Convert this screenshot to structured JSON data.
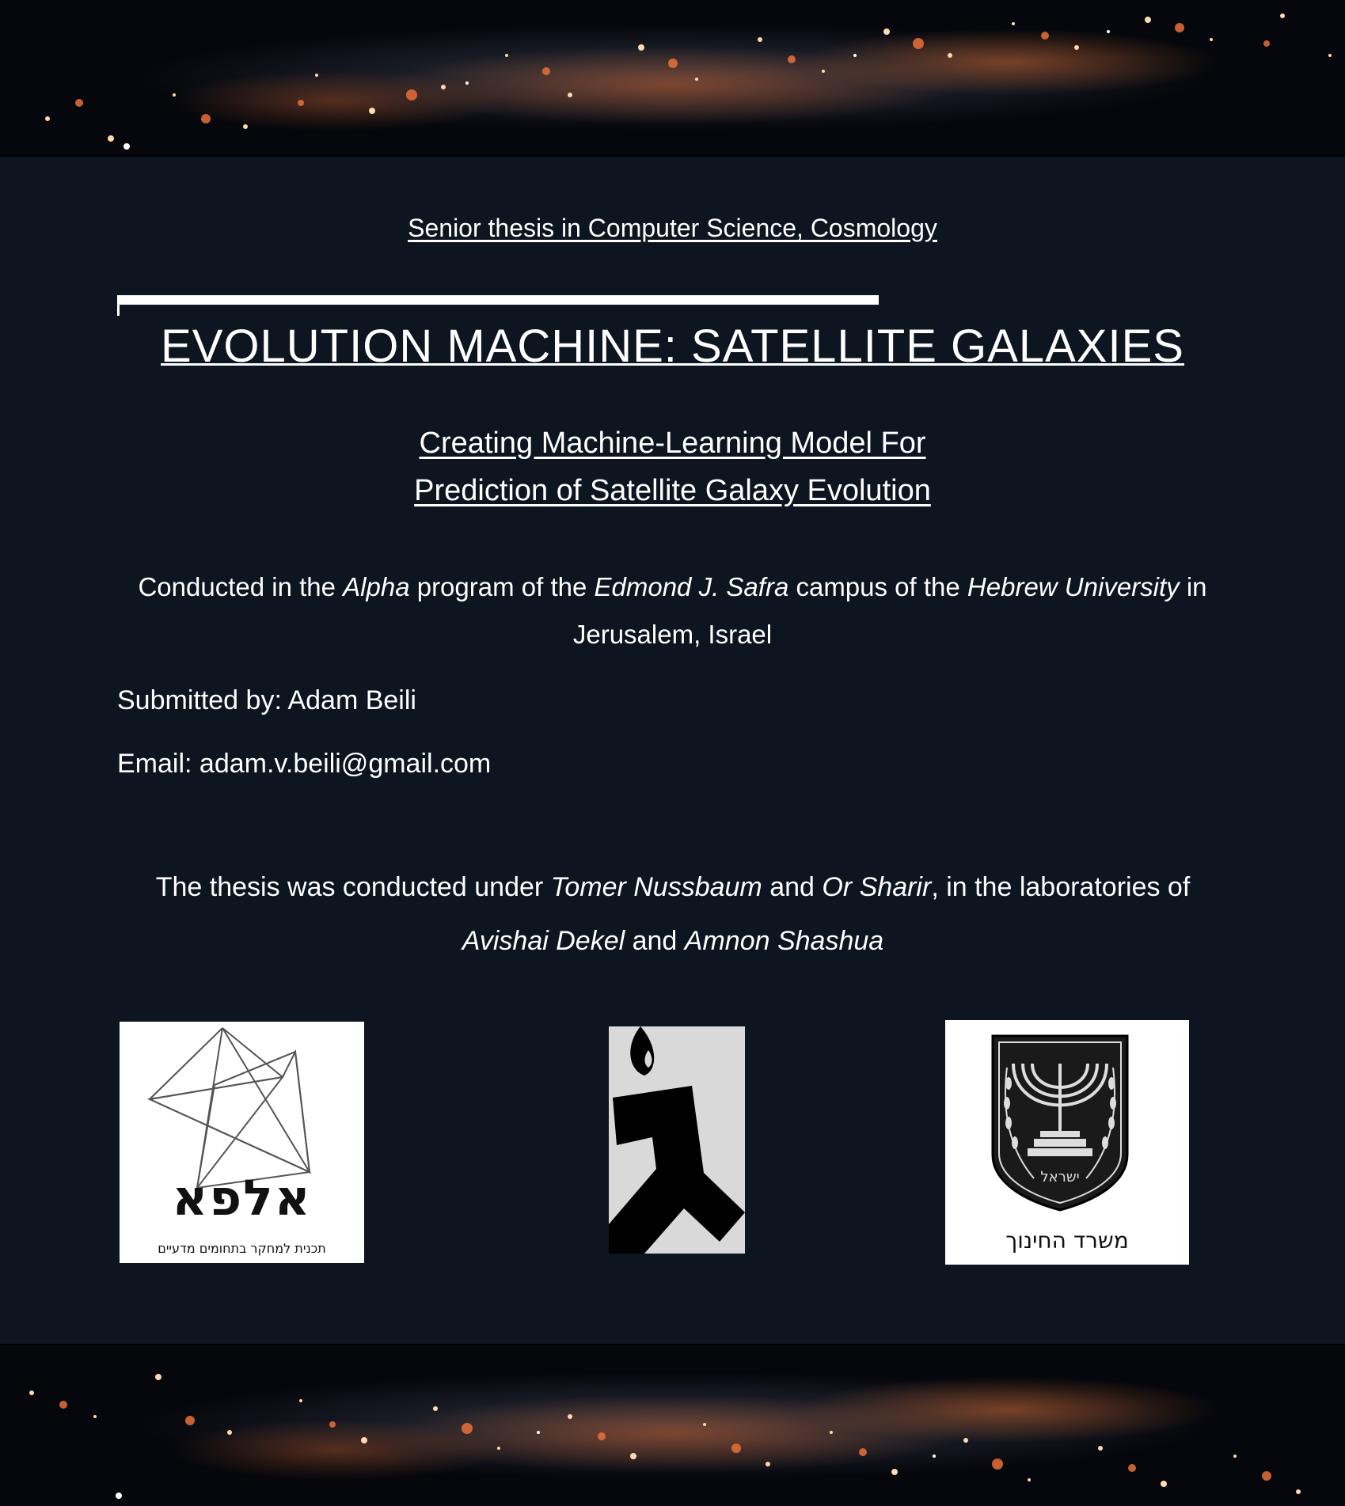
{
  "header": {
    "topic": "Senior thesis in Computer Science, Cosmology",
    "title": "EVOLUTION MACHINE: SATELLITE GALAXIES",
    "subtitle_line1": "Creating Machine-Learning Model For",
    "subtitle_line2": "Prediction of Satellite Galaxy Evolution"
  },
  "conducted": {
    "t1": "Conducted in the ",
    "program": "Alpha",
    "t2": " program of the ",
    "campus": "Edmond J. Safra",
    "t3": " campus of the ",
    "university": "Hebrew University",
    "t4": " in Jerusalem, Israel"
  },
  "submitted": "Submitted by: Adam Beili",
  "email": "Email: adam.v.beili@gmail.com",
  "supervision": {
    "t1": "The thesis was conducted under ",
    "supervisor1": "Tomer Nussbaum",
    "t2": " and ",
    "supervisor2": "Or Sharir",
    "t3": ", in the laboratories of",
    "lab1": "Avishai Dekel",
    "t4": " and ",
    "lab2": "Amnon Shashua"
  },
  "logos": {
    "alpha": {
      "word": "אלפא",
      "tagline": "תכנית למחקר בתחומים מדעיים",
      "icon": "alpha-star-logo"
    },
    "gimel": {
      "icon": "gimel-logo"
    },
    "moe": {
      "emblem_word": "ישראל",
      "name": "משרד החינוך",
      "icon": "menorah-emblem"
    }
  }
}
